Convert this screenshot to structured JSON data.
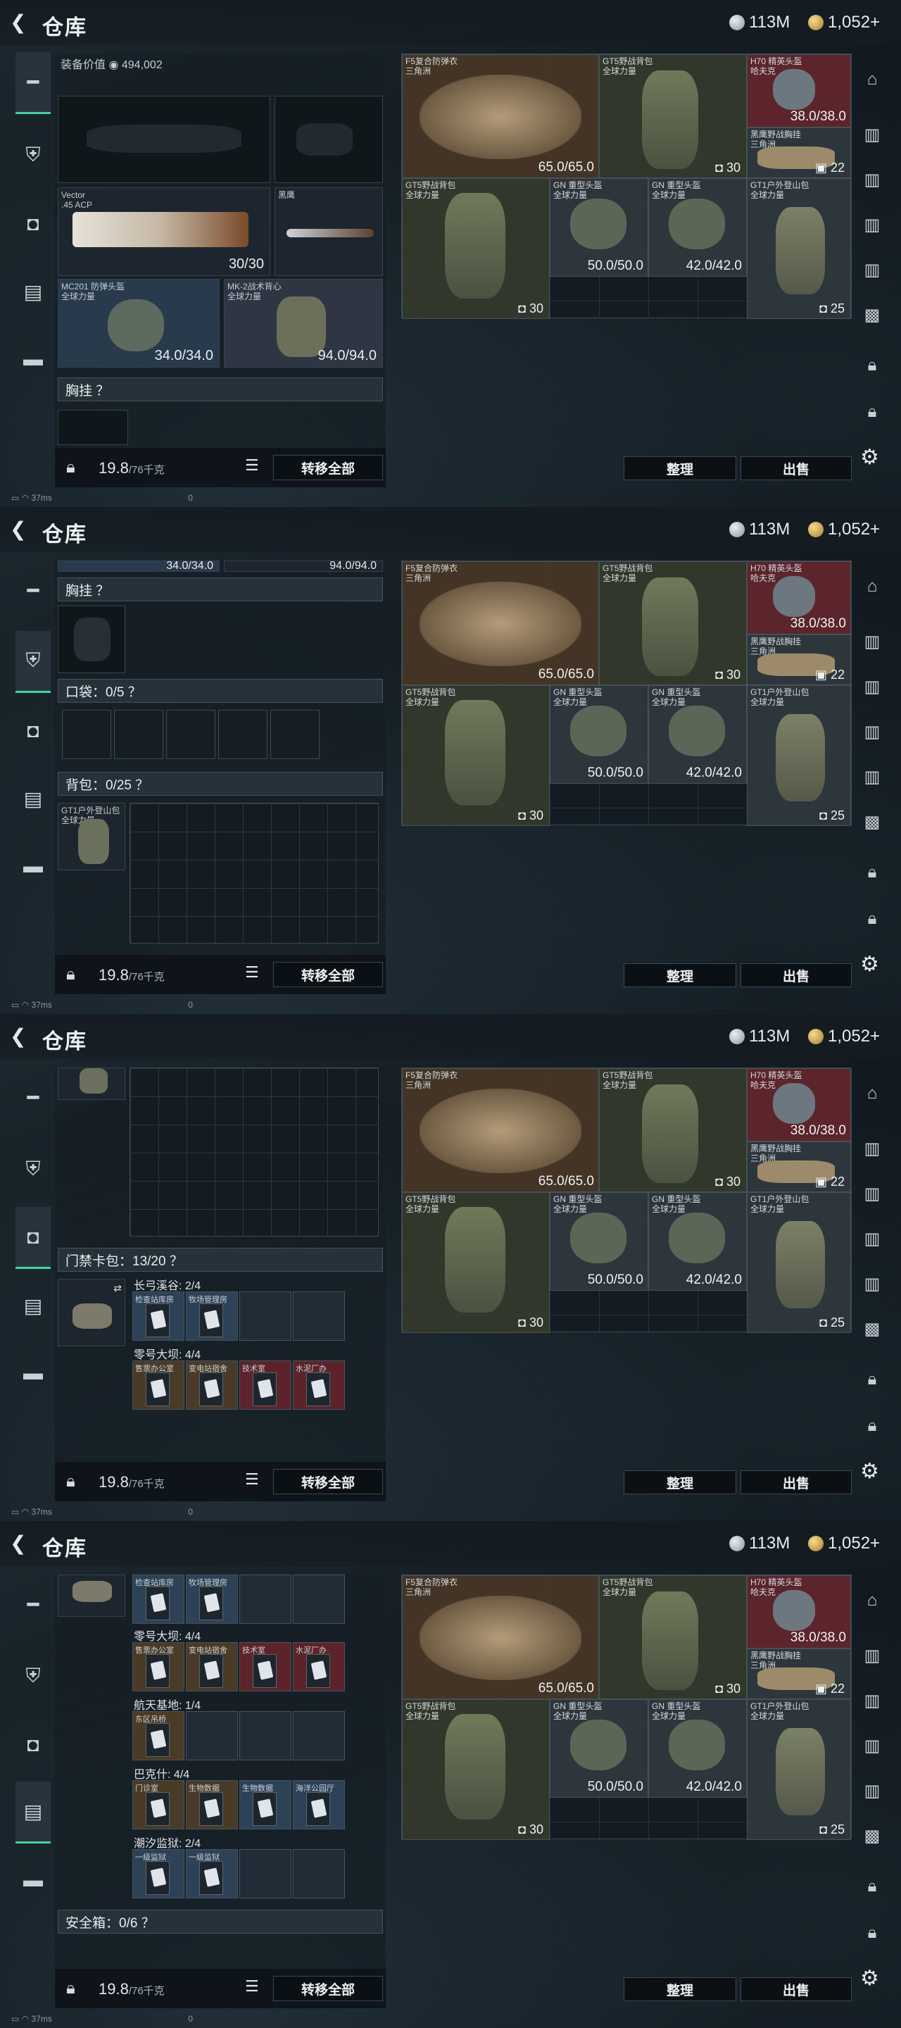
{
  "header": {
    "title": "仓库",
    "silver": "113M",
    "gold": "1,052+"
  },
  "nav": [
    "gun-icon",
    "armor-icon",
    "backpack-icon",
    "clipboard-icon",
    "toolbox-icon"
  ],
  "equip": {
    "value_label": "装备价值",
    "value": "494,002",
    "primary": {
      "name": "Vector",
      "sub": ".45 ACP",
      "ammo": "30/30"
    },
    "melee": {
      "name": "黑鹰"
    },
    "helmet": {
      "name": "MC201 防弹头盔",
      "sub": "全球力量",
      "val": "34.0/34.0"
    },
    "armor": {
      "name": "MK-2战术背心",
      "sub": "全球力量",
      "val": "94.0/94.0"
    }
  },
  "sections": {
    "chest": "胸挂 ？",
    "pocket": "口袋：0/5 ？",
    "backpack": "背包：0/25 ？",
    "keycard": "门禁卡包：13/20 ？",
    "safebox": "安全箱：0/6 ？"
  },
  "backpack_item": {
    "name": "GT1户外登山包",
    "sub": "全球力量"
  },
  "keycards": {
    "groups": [
      {
        "name": "长弓溪谷: 2/4",
        "cards": [
          "检查站库房",
          "牧场管理房"
        ]
      },
      {
        "name": "零号大坝: 4/4",
        "cards": [
          "售票办公室",
          "变电站宿舍",
          "技术室",
          "水泥厂办"
        ]
      },
      {
        "name": "航天基地: 1/4",
        "cards": [
          "东区吊桥"
        ]
      },
      {
        "name": "巴克什: 4/4",
        "cards": [
          "门诊室",
          "生物数据",
          "生物数据",
          "海洋公园厅"
        ]
      },
      {
        "name": "潮汐监狱: 2/4",
        "cards": [
          "一级监狱",
          "一级监狱"
        ]
      }
    ]
  },
  "footer": {
    "weight": "19.8",
    "unit": "/76千克",
    "transfer": "转移全部",
    "sort": "整理",
    "sell": "出售"
  },
  "stash": {
    "armor1": {
      "name": "F5复合防弹衣",
      "sub": "三角洲",
      "val": "65.0/65.0"
    },
    "pack1": {
      "name": "GT5野战背包",
      "sub": "全球力量",
      "count": "30"
    },
    "helmet1": {
      "name": "H70 精英头盔",
      "sub": "哈夫克",
      "val": "38.0/38.0"
    },
    "chest1": {
      "name": "黑鹰野战胸挂",
      "sub": "三角洲",
      "count": "22"
    },
    "pack2": {
      "name": "GT5野战背包",
      "sub": "全球力量",
      "count": "30"
    },
    "helmet2": {
      "name": "GN 重型头盔",
      "sub": "全球力量",
      "val": "50.0/50.0"
    },
    "helmet3": {
      "name": "GN 重型头盔",
      "sub": "全球力量",
      "val": "42.0/42.0"
    },
    "pack3": {
      "name": "GT1户外登山包",
      "sub": "全球力量",
      "count": "25"
    }
  },
  "status": {
    "ping": "37ms",
    "zero": "0"
  },
  "colors": {
    "accent": "#48d0a0",
    "panel": "#16202a"
  }
}
